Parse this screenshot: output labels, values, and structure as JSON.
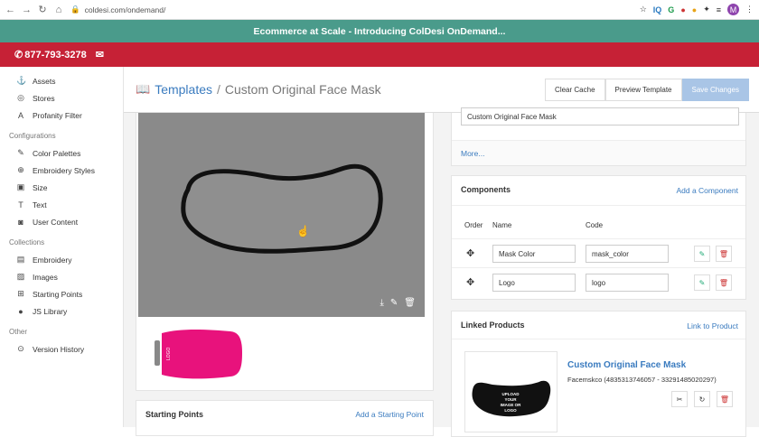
{
  "browser": {
    "url": "coldesi.com/ondemand/",
    "ext": [
      "IQ",
      "G"
    ],
    "avatar": "M"
  },
  "banner": {
    "text": "Ecommerce at Scale - Introducing ColDesi OnDemand..."
  },
  "contact": {
    "phone": "877-793-3278"
  },
  "sidebar": {
    "top_items": [
      {
        "label": "Assets",
        "icon": "anchor-icon",
        "glyph": "⚓"
      },
      {
        "label": "Stores",
        "icon": "compass-icon",
        "glyph": "◎"
      },
      {
        "label": "Profanity Filter",
        "icon": "font-icon",
        "glyph": "A"
      }
    ],
    "configurations_label": "Configurations",
    "config_items": [
      {
        "label": "Color Palettes",
        "icon": "brush-icon",
        "glyph": "✎"
      },
      {
        "label": "Embroidery Styles",
        "icon": "globe-icon",
        "glyph": "⊕"
      },
      {
        "label": "Size",
        "icon": "car-icon",
        "glyph": "▣"
      },
      {
        "label": "Text",
        "icon": "text-icon",
        "glyph": "T"
      },
      {
        "label": "User Content",
        "icon": "camera-icon",
        "glyph": "◙"
      }
    ],
    "collections_label": "Collections",
    "collection_items": [
      {
        "label": "Embroidery",
        "icon": "book-icon",
        "glyph": "▤"
      },
      {
        "label": "Images",
        "icon": "image-icon",
        "glyph": "▨"
      },
      {
        "label": "Starting Points",
        "icon": "grid-icon",
        "glyph": "⊞"
      },
      {
        "label": "JS Library",
        "icon": "node-icon",
        "glyph": "●"
      }
    ],
    "other_label": "Other",
    "other_items": [
      {
        "label": "Version History",
        "icon": "history-icon",
        "glyph": "⊙"
      }
    ]
  },
  "header": {
    "title": "Templates",
    "separator": "/",
    "subtitle": "Custom Original Face Mask",
    "buttons": {
      "clear_cache": "Clear Cache",
      "preview": "Preview Template",
      "save": "Save Changes"
    }
  },
  "details": {
    "name_value": "Custom Original Face Mask",
    "more": "More..."
  },
  "components": {
    "title": "Components",
    "add": "Add a Component",
    "col_order": "Order",
    "col_name": "Name",
    "col_code": "Code",
    "rows": [
      {
        "name": "Mask Color",
        "code": "mask_color"
      },
      {
        "name": "Logo",
        "code": "logo"
      }
    ]
  },
  "linked": {
    "title": "Linked Products",
    "link": "Link to Product",
    "product_title": "Custom Original Face Mask",
    "product_meta": "Facemskco (4835313746057 - 33291485020297)",
    "mask_text": "UPLOAD YOUR IMAGE OR LOGO"
  },
  "starting_points": {
    "title": "Starting Points",
    "add": "Add a Starting Point"
  },
  "colors": {
    "banner": "#4a9b8b",
    "red": "#c62136",
    "accent": "#3a7bbf",
    "mask_pink": "#e8127c"
  }
}
